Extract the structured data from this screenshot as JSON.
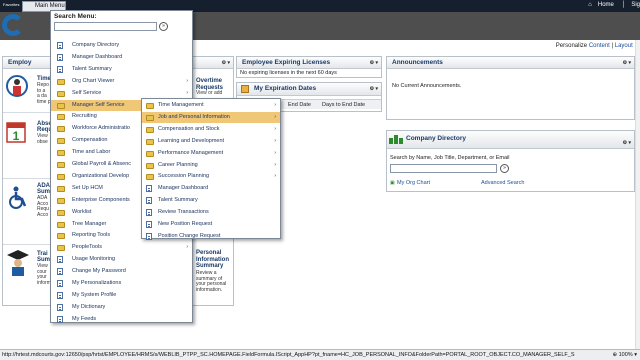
{
  "topbar": {
    "favorites": "Favorites",
    "main_menu": "Main Menu",
    "home": "Home",
    "sign": "Sig"
  },
  "personalize": {
    "label": "Personalize",
    "content": "Content",
    "sep": "|",
    "layout": "Layout",
    "sep2": "|"
  },
  "employee_pagelet": {
    "title": "Employ",
    "items": [
      {
        "title": "Time",
        "desc": "Repo\nto a\na da\ntime p"
      },
      {
        "title": "Abse\nRequ",
        "desc": "View\nobse"
      },
      {
        "title": "ADA\nSumm",
        "desc": "ADA\nAcco\nRequ\nAcco"
      },
      {
        "title": "Trai\nSumm",
        "desc": "View\ncour\nyour\ninform"
      }
    ],
    "overtime_title": "Overtime\nRequests",
    "overtime_desc": "View or add",
    "personal_title": "Personal\nInformation\nSummary",
    "personal_desc": "Review a\nsummary of\nyour personal\ninformation."
  },
  "expiring": {
    "title": "Employee Expiring Licenses",
    "text": "No expiring licenses in the next 60 days"
  },
  "my_expiration": {
    "title": "My Expiration Dates",
    "col1": "End Date",
    "col2": "Days to End Date"
  },
  "announcements": {
    "title": "Announcements",
    "text": "No Current Announcements."
  },
  "company_dir": {
    "title": "Company Directory",
    "search_label": "Search by Name, Job Title, Department, or Email",
    "org_chart": "My Org Chart",
    "advanced": "Advanced Search"
  },
  "search_menu": {
    "title": "Search Menu:",
    "items": [
      {
        "label": "Company Directory",
        "type": "doc",
        "sub": false
      },
      {
        "label": "Manager Dashboard",
        "type": "doc",
        "sub": false
      },
      {
        "label": "Talent Summary",
        "type": "doc",
        "sub": false
      },
      {
        "label": "Org Chart Viewer",
        "type": "folder",
        "sub": true
      },
      {
        "label": "Self Service",
        "type": "folder",
        "sub": true
      },
      {
        "label": "Manager Self Service",
        "type": "folder",
        "sub": true,
        "hl": true
      },
      {
        "label": "Recruiting",
        "type": "folder",
        "sub": true
      },
      {
        "label": "Workforce Administratio",
        "type": "folder",
        "sub": true
      },
      {
        "label": "Compensation",
        "type": "folder",
        "sub": true
      },
      {
        "label": "Time and Labor",
        "type": "folder",
        "sub": true
      },
      {
        "label": "Global Payroll & Absenc",
        "type": "folder",
        "sub": true
      },
      {
        "label": "Organizational Develop",
        "type": "folder",
        "sub": true
      },
      {
        "label": "Set Up HCM",
        "type": "folder",
        "sub": true
      },
      {
        "label": "Enterprise Components",
        "type": "folder",
        "sub": true
      },
      {
        "label": "Worklist",
        "type": "folder",
        "sub": true
      },
      {
        "label": "Tree Manager",
        "type": "folder",
        "sub": true
      },
      {
        "label": "Reporting Tools",
        "type": "folder",
        "sub": true
      },
      {
        "label": "PeopleTools",
        "type": "folder",
        "sub": true
      },
      {
        "label": "Usage Monitoring",
        "type": "doc",
        "sub": false
      },
      {
        "label": "Change My Password",
        "type": "doc",
        "sub": false
      },
      {
        "label": "My Personalizations",
        "type": "doc",
        "sub": false
      },
      {
        "label": "My System Profile",
        "type": "doc",
        "sub": false
      },
      {
        "label": "My Dictionary",
        "type": "doc",
        "sub": false
      },
      {
        "label": "My Feeds",
        "type": "doc",
        "sub": false
      }
    ]
  },
  "manager_menu": {
    "items": [
      {
        "label": "Time Management",
        "type": "folder",
        "sub": true
      },
      {
        "label": "Job and Personal Information",
        "type": "folder",
        "sub": true,
        "hl": true
      },
      {
        "label": "Compensation and Stock",
        "type": "folder",
        "sub": true
      },
      {
        "label": "Learning and Development",
        "type": "folder",
        "sub": true
      },
      {
        "label": "Performance Management",
        "type": "folder",
        "sub": true
      },
      {
        "label": "Career Planning",
        "type": "folder",
        "sub": true
      },
      {
        "label": "Succession Planning",
        "type": "folder",
        "sub": true
      },
      {
        "label": "Manager Dashboard",
        "type": "doc",
        "sub": false
      },
      {
        "label": "Talent Summary",
        "type": "doc",
        "sub": false
      },
      {
        "label": "Review Transactions",
        "type": "doc",
        "sub": false
      },
      {
        "label": "New Position Request",
        "type": "doc",
        "sub": false
      },
      {
        "label": "Position Change Request",
        "type": "doc",
        "sub": false
      }
    ]
  },
  "status": {
    "url": "http://hrtest.mdcourts.gov:12650/psp/hrtst/EMPLOYEE/HRMS/s/WEBLIB_PTPP_SC.HOMEPAGE.FieldFormula.IScript_AppHP?pt_fname=HC_JOB_PERSONAL_INFO&FolderPath=PORTAL_ROOT_OBJECT.CO_MANAGER_SELF_S",
    "zoom": "100%"
  }
}
